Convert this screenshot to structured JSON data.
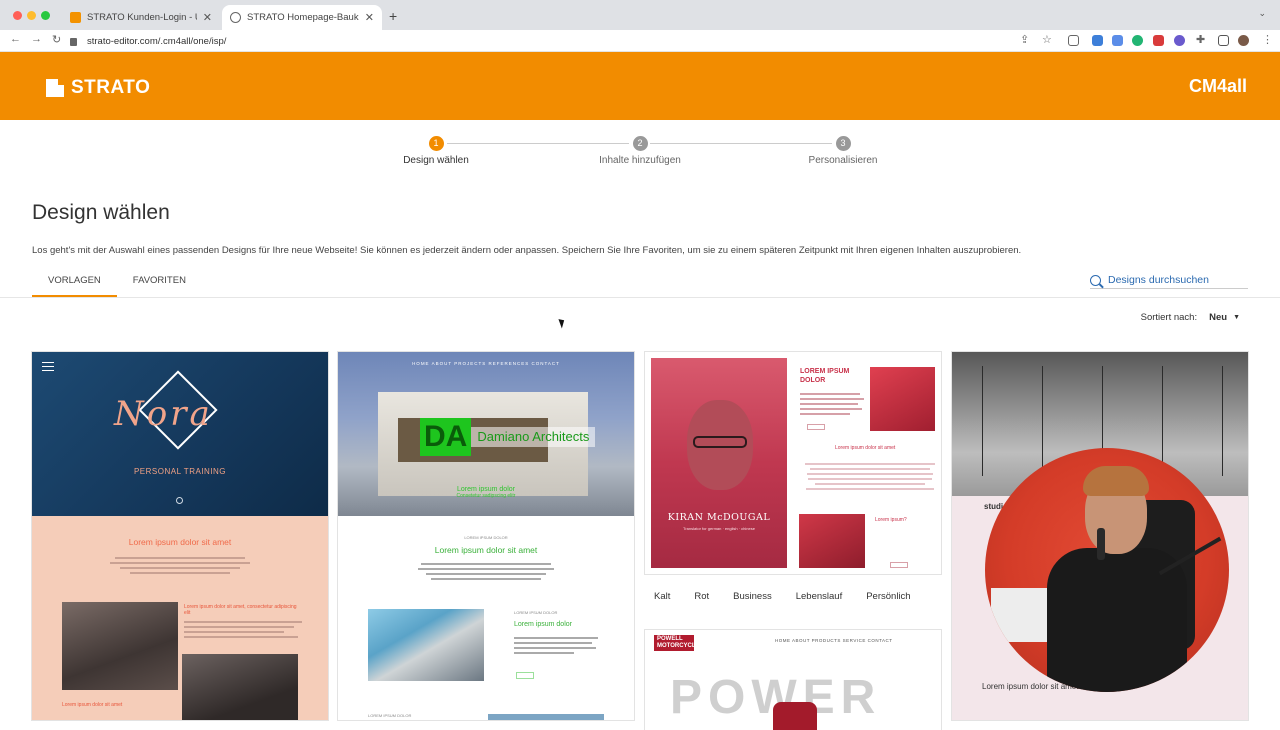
{
  "browser": {
    "tabs": [
      {
        "title": "STRATO Kunden-Login - Über"
      },
      {
        "title": "STRATO Homepage-Baukasten"
      }
    ],
    "new_tab": "+",
    "url": "strato-editor.com/.cm4all/one/isp/"
  },
  "header": {
    "logo_text": "STRATO",
    "partner_logo": "CM4all"
  },
  "stepper": {
    "steps": [
      {
        "number": "1",
        "label": "Design wählen"
      },
      {
        "number": "2",
        "label": "Inhalte hinzufügen"
      },
      {
        "number": "3",
        "label": "Personalisieren"
      }
    ]
  },
  "page": {
    "title": "Design wählen",
    "description": "Los geht's mit der Auswahl eines passenden Designs für Ihre neue Webseite! Sie können es jederzeit ändern oder anpassen. Speichern Sie Ihre Favoriten, um sie zu einem späteren Zeitpunkt mit Ihren eigenen Inhalten auszuprobieren."
  },
  "tabs": [
    {
      "label": "VORLAGEN"
    },
    {
      "label": "FAVORITEN"
    }
  ],
  "search": {
    "label": "Designs durchsuchen"
  },
  "sort": {
    "label": "Sortiert nach:",
    "value": "Neu"
  },
  "templates": [
    {
      "hero_script": "Nora",
      "hero_subtitle": "PERSONAL TRAINING",
      "heading": "Lorem ipsum dolor sit amet",
      "small_heading": "Lorem ipsum dolor sit amet, consectetur adipiscing elit",
      "small_heading_2": "Lorem ipsum dolor sit amet"
    },
    {
      "nav": "HOME  ABOUT  PROJECTS  REFERENCES  CONTACT",
      "logo_mark": "DA",
      "logo_name": "Damiano Architects",
      "tagline": "Lorem ipsum dolor",
      "tagline_sub": "Consetetur sadipscing elitr",
      "small_label": "LOREM IPSUM DOLOR",
      "heading": "Lorem ipsum dolor sit amet",
      "small_label_2": "LOREM IPSUM DOLOR",
      "subheading": "Lorem ipsum dolor",
      "small_label_3": "LOREM IPSUM DOLOR"
    },
    {
      "title": "LOREM IPSUM DOLOR",
      "name": "KIRAN McDOUGAL",
      "name_sub": "Translator for german · english · chinese",
      "line1": "Lorem ipsum dolor sit amet",
      "line2": "Lorem ipsum?",
      "tags": [
        "Kalt",
        "Rot",
        "Business",
        "Lebenslauf",
        "Persönlich"
      ]
    },
    {
      "studio": "studio",
      "lorem": "Lorem ipsum dolor sit amet"
    },
    {
      "logo": "POWELL MOTORCYCLE",
      "nav": "HOME  ABOUT  PRODUCTS  SERVICE  CONTACT",
      "hero": "POWER"
    }
  ]
}
